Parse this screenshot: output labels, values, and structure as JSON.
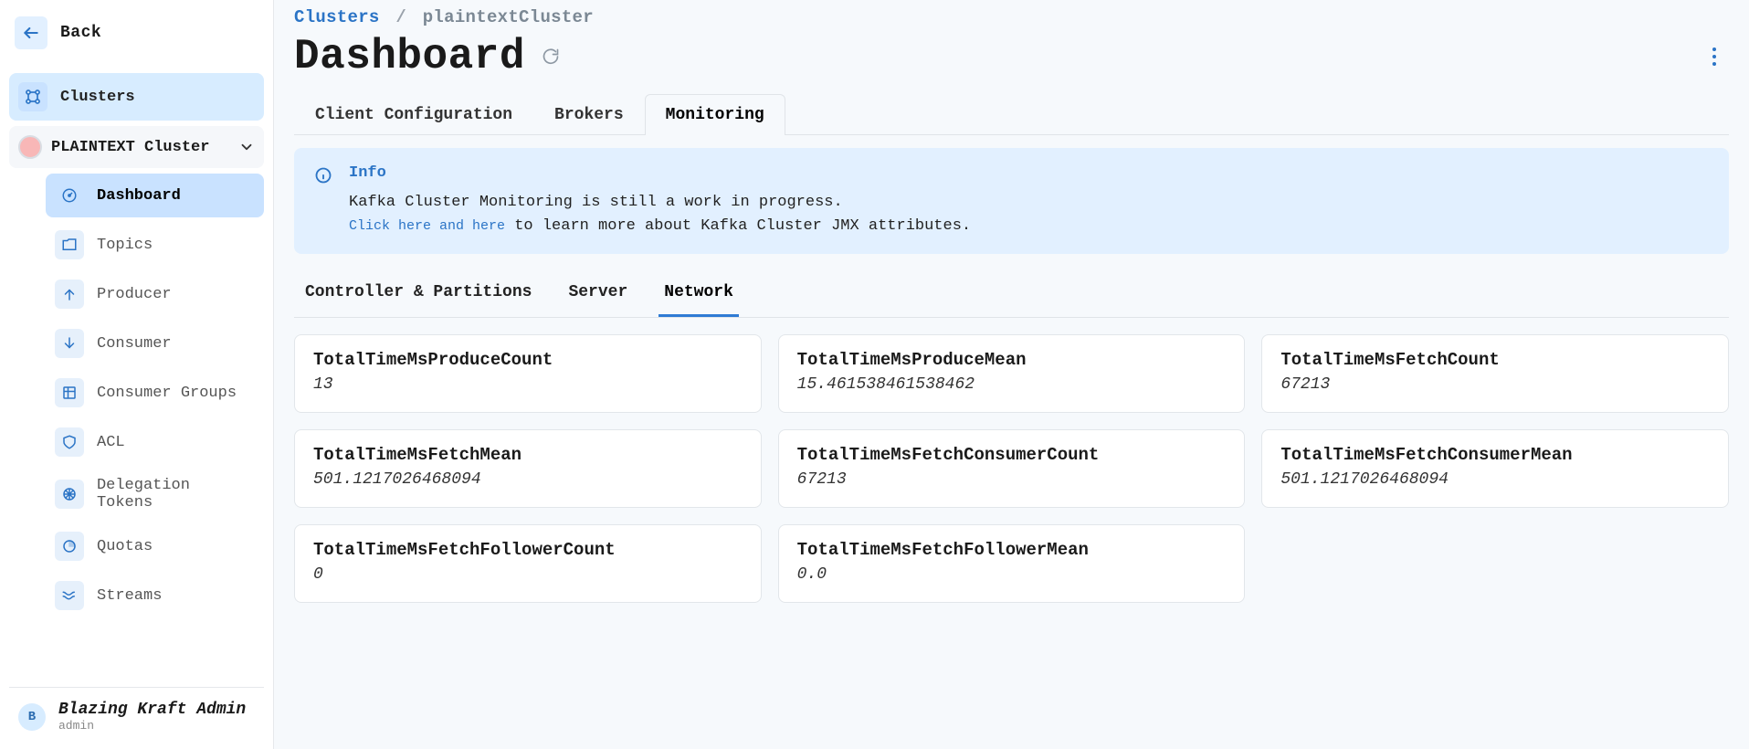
{
  "back_label": "Back",
  "sidebar": {
    "clusters_label": "Clusters",
    "cluster_name": "PLAINTEXT Cluster",
    "items": [
      {
        "label": "Dashboard"
      },
      {
        "label": "Topics"
      },
      {
        "label": "Producer"
      },
      {
        "label": "Consumer"
      },
      {
        "label": "Consumer Groups"
      },
      {
        "label": "ACL"
      },
      {
        "label": "Delegation Tokens"
      },
      {
        "label": "Quotas"
      },
      {
        "label": "Streams"
      }
    ]
  },
  "footer": {
    "avatar_initial": "B",
    "user_name": "Blazing Kraft Admin",
    "user_role": "admin"
  },
  "breadcrumb": {
    "root": "Clusters",
    "sep": "/",
    "current": "plaintextCluster"
  },
  "page_title": "Dashboard",
  "tabs": [
    {
      "label": "Client Configuration"
    },
    {
      "label": "Brokers"
    },
    {
      "label": "Monitoring"
    }
  ],
  "info": {
    "title": "Info",
    "text": "Kafka Cluster Monitoring is still a work in progress.",
    "link_text": "Click here and here",
    "rest_text": " to learn more about Kafka Cluster JMX attributes."
  },
  "subtabs": [
    {
      "label": "Controller & Partitions"
    },
    {
      "label": "Server"
    },
    {
      "label": "Network"
    }
  ],
  "metrics": [
    {
      "title": "TotalTimeMsProduceCount",
      "value": "13"
    },
    {
      "title": "TotalTimeMsProduceMean",
      "value": "15.461538461538462"
    },
    {
      "title": "TotalTimeMsFetchCount",
      "value": "67213"
    },
    {
      "title": "TotalTimeMsFetchMean",
      "value": "501.1217026468094"
    },
    {
      "title": "TotalTimeMsFetchConsumerCount",
      "value": "67213"
    },
    {
      "title": "TotalTimeMsFetchConsumerMean",
      "value": "501.1217026468094"
    },
    {
      "title": "TotalTimeMsFetchFollowerCount",
      "value": "0"
    },
    {
      "title": "TotalTimeMsFetchFollowerMean",
      "value": "0.0"
    }
  ]
}
